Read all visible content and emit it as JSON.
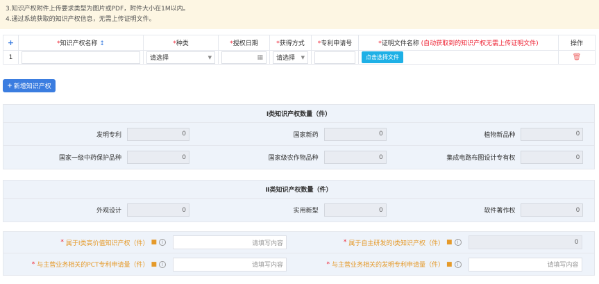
{
  "notice": {
    "line3": "3.知识产权附件上传要求类型为图片或PDF，附件大小在1M以内。",
    "line4": "4.通过系统获取的知识产权信息，无需上传证明文件。"
  },
  "table": {
    "headers": {
      "add": "+",
      "name": "知识产权名称",
      "type": "种类",
      "date": "授权日期",
      "method": "获得方式",
      "patent_no": "专利申请号",
      "proof": "证明文件名称",
      "proof_note": "(自动获取到的知识产权无需上传证明文件)",
      "op": "操作"
    },
    "rows": [
      {
        "index": "1",
        "type": "请选择",
        "method": "请选择",
        "upload": "点击选择文件"
      }
    ]
  },
  "add_button": "新增知识产权",
  "class1": {
    "title": "Ⅰ类知识产权数量（件）",
    "items": [
      {
        "label": "发明专利",
        "value": "0"
      },
      {
        "label": "国家新药",
        "value": "0"
      },
      {
        "label": "植物新品种",
        "value": "0"
      },
      {
        "label": "国家一级中药保护品种",
        "value": "0"
      },
      {
        "label": "国家级农作物品种",
        "value": "0"
      },
      {
        "label": "集成电路布图设计专有权",
        "value": "0"
      }
    ]
  },
  "class2": {
    "title": "Ⅱ类知识产权数量（件）",
    "items": [
      {
        "label": "外观设计",
        "value": "0"
      },
      {
        "label": "实用新型",
        "value": "0"
      },
      {
        "label": "软件著作权",
        "value": "0"
      }
    ]
  },
  "extra": {
    "items": [
      {
        "label": "属于Ⅰ类高价值知识产权（件）",
        "placeholder": "请填写内容",
        "value": ""
      },
      {
        "label": "属于自主研发的Ⅰ类知识产权（件）",
        "placeholder": "",
        "value": "0"
      },
      {
        "label": "与主营业务相关的PCT专利申请量（件）",
        "placeholder": "请填写内容",
        "value": ""
      },
      {
        "label": "与主营业务相关的发明专利申请量（件）",
        "placeholder": "请填写内容",
        "value": ""
      }
    ]
  }
}
